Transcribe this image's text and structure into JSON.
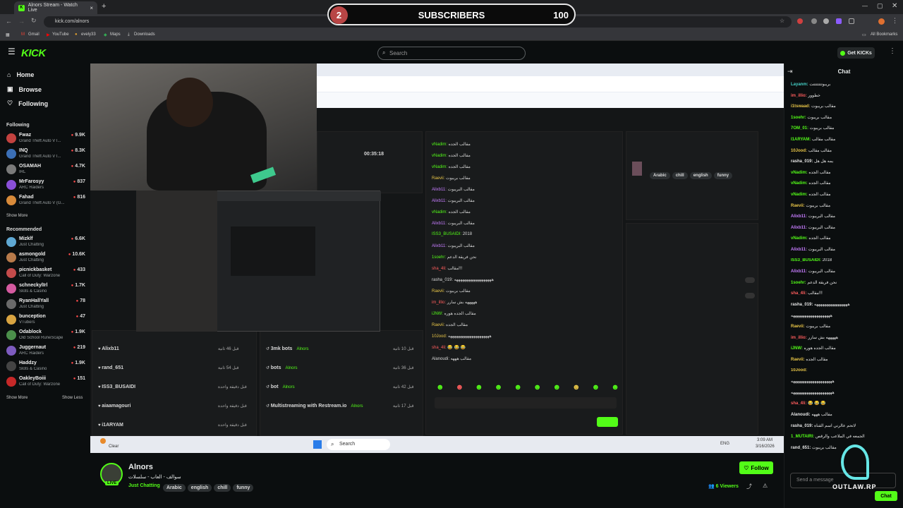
{
  "browser": {
    "tab_title": "Alnors Stream - Watch Live",
    "url": "kick.com/alnors",
    "bookmarks": [
      "Gmail",
      "YouTube",
      "evely33",
      "Maps",
      "Downloads"
    ],
    "all_bookmarks": "All Bookmarks"
  },
  "overlay": {
    "current": "2",
    "label": "SUBSCRIBERS",
    "goal": "100"
  },
  "nav": {
    "logo": "KICK",
    "search_placeholder": "Search",
    "get_kicks": "Get KICKs"
  },
  "sidebar": {
    "home": "Home",
    "browse": "Browse",
    "following": "Following",
    "following_title": "Following",
    "following_list": [
      {
        "name": "Fwaz",
        "game": "Grand Theft Auto V I...",
        "viewers": "9.9K",
        "color": "#c3423f"
      },
      {
        "name": "INQ",
        "game": "Grand Theft Auto V I...",
        "viewers": "8.3K",
        "color": "#3b6fb6"
      },
      {
        "name": "OSAMAH",
        "game": "IRL",
        "viewers": "4.7K",
        "color": "#7a7a7a"
      },
      {
        "name": "MrFarosyy",
        "game": "ARC Raiders",
        "viewers": "837",
        "color": "#8a4fd8"
      },
      {
        "name": "Fahad",
        "game": "Grand Theft Auto V (G...",
        "viewers": "816",
        "color": "#d88a3a"
      }
    ],
    "show_more": "Show More",
    "recommended_title": "Recommended",
    "recommended_list": [
      {
        "name": "Mizklf",
        "game": "Just Chatting",
        "viewers": "6.6K",
        "color": "#5fa8d3"
      },
      {
        "name": "asmongold",
        "game": "Just Chatting",
        "viewers": "10.6K",
        "color": "#b77a4a"
      },
      {
        "name": "picnickbasket",
        "game": "Call of Duty: Warzone",
        "viewers": "433",
        "color": "#c34b4b"
      },
      {
        "name": "schneckylïrl",
        "game": "Slots & Casino",
        "viewers": "1.7K",
        "color": "#d45aa0"
      },
      {
        "name": "RyanHallYall",
        "game": "Just Chatting",
        "viewers": "78",
        "color": "#6a6a6a"
      },
      {
        "name": "bunception",
        "game": "VTubers",
        "viewers": "47",
        "color": "#d9a441"
      },
      {
        "name": "Odablock",
        "game": "Old School RuneScape",
        "viewers": "1.9K",
        "color": "#4b8f4b"
      },
      {
        "name": "Juggernaut",
        "game": "ARC Raiders",
        "viewers": "219",
        "color": "#7d5bbf"
      },
      {
        "name": "Haddzy",
        "game": "Slots & Casino",
        "viewers": "1.9K",
        "color": "#444"
      },
      {
        "name": "OakleyBoiii",
        "game": "Call of Duty: Warzone",
        "viewers": "151",
        "color": "#c62828"
      }
    ],
    "show_more2": "Show More",
    "show_less": "Show Less"
  },
  "stream_video": {
    "timer": "00:35:18",
    "inner_chat": [
      {
        "u": "vNadim:",
        "t": "مقالب الجده",
        "c": "vg"
      },
      {
        "u": "vNadim:",
        "t": "مقالب الجده",
        "c": "vg"
      },
      {
        "u": "vNadim:",
        "t": "مقالب الجده",
        "c": "vg"
      },
      {
        "u": "Raevii:",
        "t": "مقالب بريبوت",
        "c": "vy"
      },
      {
        "u": "Alixb11:",
        "t": "مقالب البريبوت",
        "c": "vp"
      },
      {
        "u": "Alixb11:",
        "t": "مقالب البريبوت",
        "c": "vp"
      },
      {
        "u": "vNadim:",
        "t": "مقالب الجده",
        "c": "vg"
      },
      {
        "u": "Alixb11:",
        "t": "مقالب البريبوت",
        "c": "vp"
      },
      {
        "u": "ISS3_BUSAIDI:",
        "t": "2018",
        "c": "vg"
      },
      {
        "u": "Alixb11:",
        "t": "مقالب البريبوت",
        "c": "vp"
      },
      {
        "u": "1soehr:",
        "t": "نحن فريقة الدعم",
        "c": "vg"
      },
      {
        "u": "sha_4li:",
        "t": "مقالب!!!",
        "c": "vr"
      },
      {
        "u": "rasha_019:",
        "t": "هههههههههههههههههههه",
        "c": ""
      },
      {
        "u": "Raevii:",
        "t": "مقالب بريبوت",
        "c": "vy"
      },
      {
        "u": "im_illio:",
        "t": "هههههه بش سارر",
        "c": "vr"
      },
      {
        "u": "iJNW:",
        "t": "مقالب الجده هوره",
        "c": "vg"
      },
      {
        "u": "Raevii:",
        "t": "مقالب الجده",
        "c": "vy"
      },
      {
        "u": "10Jood:",
        "t": "هههههههههههههههههههههه",
        "c": "vy"
      },
      {
        "u": "sha_4li:",
        "t": "😂 😂 😂",
        "c": "vr"
      },
      {
        "u": "Alanoudi:",
        "t": "مقالب هههه",
        "c": ""
      }
    ],
    "activity_list": [
      {
        "name": "Alixb11",
        "time": "قبل 46 ثانية"
      },
      {
        "name": "rand_651",
        "time": "قبل 54 ثانية"
      },
      {
        "name": "ISS3_BUSAIDI",
        "time": "قبل دقيقة واحدة"
      },
      {
        "name": "aiaamagouri",
        "time": "قبل دقيقة واحدة"
      },
      {
        "name": "i1ARYAM",
        "time": "قبل دقيقة واحدة"
      }
    ],
    "mod_list": [
      {
        "name": "3mk bots",
        "time": "قبل 10 ثانية",
        "by": "Alnors"
      },
      {
        "name": "bots",
        "time": "قبل 36 ثانية",
        "by": "Alnors"
      },
      {
        "name": "bot",
        "time": "قبل 42 ثانية",
        "by": "Alnors"
      },
      {
        "name": "Multistreaming with Restream.io",
        "time": "قبل 17 ثانية",
        "by": "Alnors"
      }
    ],
    "info_tags": [
      "Arabic",
      "chill",
      "english",
      "funny"
    ],
    "taskbar_search": "Search",
    "taskbar_time": "3:09 AM",
    "taskbar_date": "3/16/2026",
    "taskbar_lang": "ENG",
    "weather": "Clear"
  },
  "streamer": {
    "name": "Alnors",
    "title": "سوالف - العاب - سلسلات",
    "category": "Just Chatting",
    "tags": [
      "Arabic",
      "english",
      "chill",
      "funny"
    ],
    "live": "LIVE",
    "follow": "Follow",
    "viewers": "6 Viewers"
  },
  "chat": {
    "title": "Chat",
    "messages": [
      {
        "u": "Layanm:",
        "t": "بريبوتتتتتتتت",
        "c": "cy"
      },
      {
        "u": "im_illio:",
        "t": "خطوور",
        "c": "rd"
      },
      {
        "u": "i1tswaad:",
        "t": "مقالب بريبوت",
        "c": "yl"
      },
      {
        "u": "1soehr:",
        "t": "مقالب بريبوت",
        "c": "gr"
      },
      {
        "u": "7OM_01:",
        "t": "مقالب بريبوت",
        "c": "gr"
      },
      {
        "u": "I1ARYAM:",
        "t": "مقالب مقالب",
        "c": "gr"
      },
      {
        "u": "10Jood:",
        "t": "مقالب مقالب",
        "c": "yl"
      },
      {
        "u": "rasha_019:",
        "t": "يمه هل هل",
        "c": ""
      },
      {
        "u": "vNadim:",
        "t": "مقالب الجده",
        "c": "gr"
      },
      {
        "u": "vNadim:",
        "t": "مقالب الجده",
        "c": "gr"
      },
      {
        "u": "vNadim:",
        "t": "مقالب الجده",
        "c": "gr"
      },
      {
        "u": "Raevii:",
        "t": "مقالب بريبوت",
        "c": "yl"
      },
      {
        "u": "Alixb11:",
        "t": "مقالب البريبوت",
        "c": "pu"
      },
      {
        "u": "Alixb11:",
        "t": "مقالب البريبوت",
        "c": "pu"
      },
      {
        "u": "vNadim:",
        "t": "مقالب الجده",
        "c": "gr"
      },
      {
        "u": "Alixb11:",
        "t": "مقالب البريبوت",
        "c": "pu"
      },
      {
        "u": "ISS3_BUSAIDI:",
        "t": "2018",
        "c": "gr"
      },
      {
        "u": "Alixb11:",
        "t": "مقالب البريبوت",
        "c": "pu"
      },
      {
        "u": "1soehr:",
        "t": "نحن فريقة الدعم",
        "c": "gr"
      },
      {
        "u": "sha_4li:",
        "t": "مقالب!!!",
        "c": "rd"
      },
      {
        "u": "rasha_019:",
        "t": "هههههههههههههههههه",
        "c": ""
      },
      {
        "u": "",
        "t": "ههههههههههههههههههههه",
        "c": ""
      },
      {
        "u": "Raevii:",
        "t": "مقالب بريبوت",
        "c": "yl"
      },
      {
        "u": "im_illio:",
        "t": "هههههه بش سارر",
        "c": "rd"
      },
      {
        "u": "iJNW:",
        "t": "مقالب الجده هوره",
        "c": "gr"
      },
      {
        "u": "Raevii:",
        "t": "مقالب الجده",
        "c": "yl"
      },
      {
        "u": "10Jood:",
        "t": "",
        "c": "yl"
      },
      {
        "u": "",
        "t": "هههههههههههههههههههههه",
        "c": ""
      },
      {
        "u": "",
        "t": "هههههههههههههههههههههه",
        "c": ""
      },
      {
        "u": "sha_4li:",
        "t": "😂 😂 😂",
        "c": "rd"
      },
      {
        "u": "Alanoudi:",
        "t": "مقالب هههه",
        "c": ""
      },
      {
        "u": "rasha_019:",
        "t": "لاتحم عالرني اسم القناة",
        "c": ""
      },
      {
        "u": "1_MUTAIRI:",
        "t": "الجمعه في الملاعب والرقص",
        "c": "gr"
      },
      {
        "u": "rand_651:",
        "t": "مقالب بريبوت",
        "c": ""
      }
    ],
    "input_placeholder": "Send a message",
    "send": "Chat",
    "watermark": "OUTLAW.RP"
  }
}
